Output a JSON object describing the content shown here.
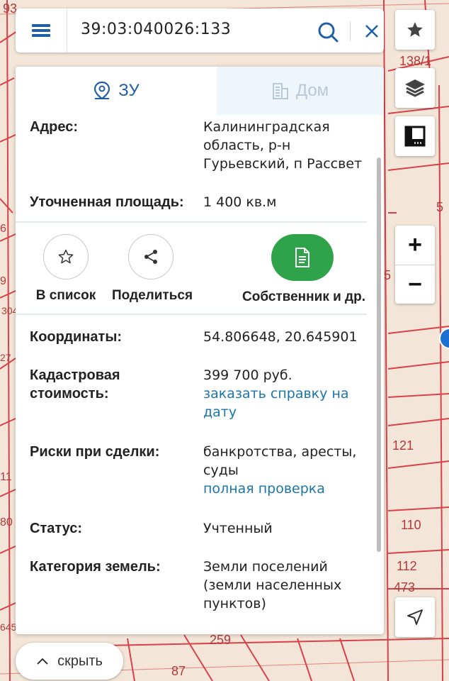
{
  "search": {
    "query": "39:03:040026:133"
  },
  "icons": {
    "menu": "menu-icon",
    "search": "search-icon",
    "clear": "close-icon",
    "favorite": "star-icon",
    "layers": "layers-icon",
    "ruler": "ruler-icon",
    "locate": "navigation-arrow-icon"
  },
  "controls": {
    "zoom_in": "+",
    "zoom_out": "−"
  },
  "tabs": [
    {
      "label": "ЗУ",
      "icon": "location-pin-icon",
      "active": true
    },
    {
      "label": "Дом",
      "icon": "building-icon",
      "active": false
    }
  ],
  "info": {
    "address_label": "Адрес:",
    "address_value": "Калининградская область, р-н Гурьевский, п Рассвет",
    "area_label": "Уточненная площадь:",
    "area_value": "1 400 кв.м",
    "coords_label": "Координаты:",
    "coords_value": "54.806648, 20.645901",
    "cadastral_label": "Кадастровая стоимость:",
    "cadastral_value": "399 700 руб.",
    "cadastral_link": "заказать справку на дату",
    "risks_label": "Риски при сделки:",
    "risks_value": "банкротства, аресты, суды",
    "risks_link": "полная проверка",
    "status_label": "Статус:",
    "status_value": "Учтенный",
    "category_label": "Категория земель:",
    "category_value": "Земли поселений (земли населенных пунктов)"
  },
  "actions": {
    "to_list": "В список",
    "share": "Поделиться",
    "owner": "Собственник и др."
  },
  "bottom": {
    "hide_label": "скрыть"
  },
  "map_labels": [
    "93",
    "138/1",
    "5",
    "5",
    "121",
    "110",
    "112",
    "473",
    "259",
    "87",
    "304",
    "27",
    "11",
    "80",
    "9",
    "6",
    "645"
  ],
  "colors": {
    "accent_blue": "#1f5fa5",
    "link": "#1b75a8",
    "green": "#2fa34a",
    "map_bg": "#f3e6d8",
    "parcel_lines": "#d9414a"
  }
}
